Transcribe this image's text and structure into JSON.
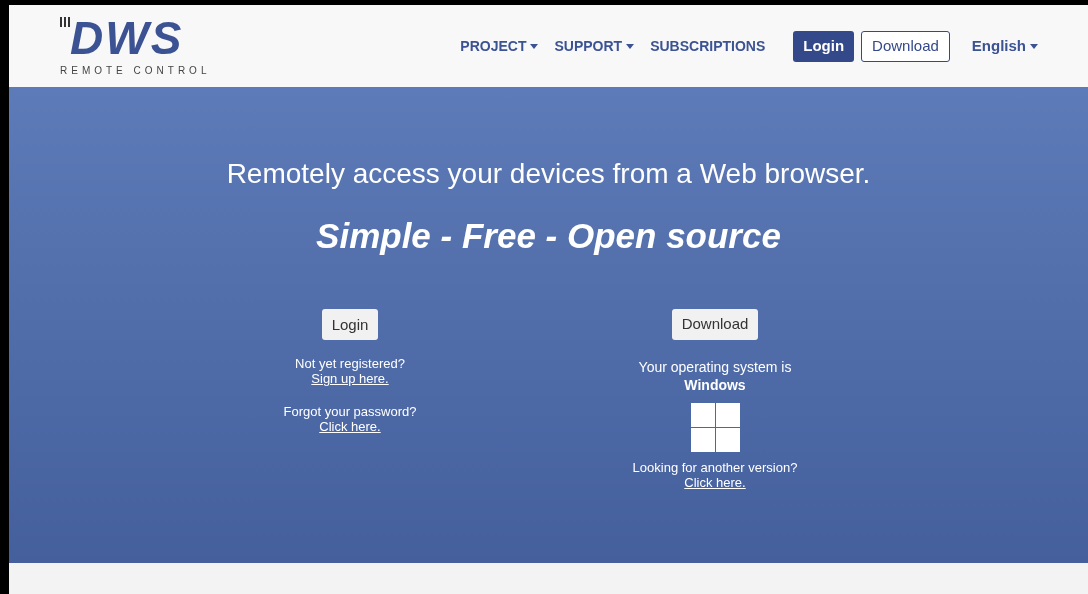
{
  "logo": {
    "mark": "DWS",
    "tagline": "REMOTE CONTROL"
  },
  "nav": {
    "items": [
      {
        "label": "PROJECT",
        "kind": "dropdown"
      },
      {
        "label": "SUPPORT",
        "kind": "dropdown"
      },
      {
        "label": "SUBSCRIPTIONS",
        "kind": "link"
      }
    ],
    "buttons": [
      {
        "label": "Login",
        "kind": "primary"
      },
      {
        "label": "Download",
        "kind": "outline"
      }
    ],
    "language": "English"
  },
  "hero": {
    "title": "Remotely access your devices from a Web browser.",
    "tagline": "Simple - Free - Open source",
    "login": {
      "button": "Login",
      "register_text": "Not yet registered?",
      "register_link": "Sign up here.",
      "forgot_text": "Forgot your password?",
      "forgot_link": "Click here."
    },
    "download": {
      "button": "Download",
      "os_text": "Your operating system is",
      "os_name": "Windows",
      "other_text": "Looking for another version?",
      "other_link": "Click here."
    }
  }
}
